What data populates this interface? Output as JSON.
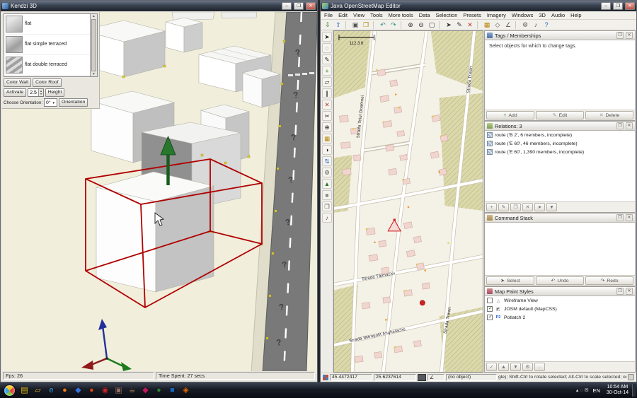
{
  "ui": {
    "icons": {
      "min": "–",
      "max": "❒",
      "close": "✕",
      "stick": "❐",
      "up": "▲",
      "down": "▼"
    }
  },
  "kendzi": {
    "title": "Kendzi 3D",
    "road_marking": "?",
    "list_items": [
      {
        "label": "flat"
      },
      {
        "label": "flat simple terraced"
      },
      {
        "label": "flat double terraced"
      }
    ],
    "color_wall": "Color Wall",
    "color_roof": "Color Roof",
    "activate": "Activate",
    "height_value": "2.5",
    "height_btn": "Height",
    "choose_orientation": "Choose Orientation:",
    "orientation_value": "0°",
    "orientation_btn": "Orientation",
    "fps": "Fps: 26",
    "time_spent": "Time Spent: 27 secs"
  },
  "josm": {
    "title": "Java OpenStreetMap Editor",
    "menus": [
      "File",
      "Edit",
      "View",
      "Tools",
      "More tools",
      "Data",
      "Selection",
      "Presets",
      "Imagery",
      "Windows",
      "3D",
      "Audio",
      "Help"
    ],
    "toolbar": [
      {
        "g": "⇩",
        "c": "#1d7a1d"
      },
      {
        "g": "⇧",
        "c": "#1f5fbf"
      },
      {
        "sep": true
      },
      {
        "g": "▣",
        "c": "#555555"
      },
      {
        "g": "❒",
        "c": "#b8860b"
      },
      {
        "sep": true
      },
      {
        "g": "↶",
        "c": "#1f8a8a"
      },
      {
        "g": "↷",
        "c": "#1f8a8a"
      },
      {
        "sep": true
      },
      {
        "g": "⊕",
        "c": "#333333"
      },
      {
        "g": "⊖",
        "c": "#333333"
      },
      {
        "g": "▢",
        "c": "#333333"
      },
      {
        "sep": true
      },
      {
        "g": "➤",
        "c": "#333333"
      },
      {
        "g": "✎",
        "c": "#333333"
      },
      {
        "g": "✕",
        "c": "#bb3333"
      },
      {
        "sep": true
      },
      {
        "g": "▦",
        "c": "#b8860b"
      },
      {
        "g": "◇",
        "c": "#555555"
      },
      {
        "g": "∠",
        "c": "#555555"
      },
      {
        "sep": true
      },
      {
        "g": "⚙",
        "c": "#555555"
      },
      {
        "g": "♪",
        "c": "#555555"
      },
      {
        "g": "?",
        "c": "#1f5fbf"
      }
    ],
    "side_toolbar": [
      {
        "g": "➤",
        "c": "#222222"
      },
      {
        "g": "◌",
        "c": "#222222"
      },
      {
        "g": "✎",
        "c": "#222222"
      },
      {
        "g": "+",
        "c": "#1d7a1d"
      },
      {
        "g": "▱",
        "c": "#222222"
      },
      {
        "g": "∥",
        "c": "#222222"
      },
      {
        "g": "✕",
        "c": "#bb3333"
      },
      {
        "g": "✂",
        "c": "#222222"
      },
      {
        "g": "⊕",
        "c": "#222222"
      },
      {
        "g": "▦",
        "c": "#b8860b"
      },
      {
        "g": "◑",
        "c": "#222222"
      },
      {
        "g": "⇅",
        "c": "#1f5fbf"
      },
      {
        "g": "⚙",
        "c": "#555555"
      },
      {
        "g": "▲",
        "c": "#2a7a2a"
      },
      {
        "g": "■",
        "c": "#888888"
      },
      {
        "g": "❒",
        "c": "#555555"
      },
      {
        "g": "♪",
        "c": "#555555"
      }
    ],
    "map": {
      "scale_label": "112.3 ft",
      "streets": [
        "Strada Teiul Doamnei",
        "Strada Traian",
        "Strada Tâlmaciei",
        "Strada Mitropolit Anghelache"
      ]
    },
    "tags_panel": {
      "title": "Tags / Memberships",
      "message": "Select objects for which to change tags.",
      "buttons": [
        {
          "g": "+",
          "label": "Add",
          "c": "#2a8a2a"
        },
        {
          "g": "✎",
          "label": "Edit",
          "c": "#999999"
        },
        {
          "g": "✕",
          "label": "Delete",
          "c": "#999999"
        }
      ]
    },
    "relations_panel": {
      "title": "Relations: 3",
      "items": [
        "route ('B 2', 6 members, incomplete)",
        "route ('E 60', 46 members, incomplete)",
        "route ('E 60', 1,390 members, incomplete)"
      ],
      "tools": [
        {
          "g": "+"
        },
        {
          "g": "✎"
        },
        {
          "g": "❐"
        },
        {
          "g": "✕"
        },
        {
          "g": "➤"
        },
        {
          "g": "▼"
        }
      ]
    },
    "command_panel": {
      "title": "Command Stack",
      "buttons": [
        {
          "g": "➤",
          "label": "Select"
        },
        {
          "g": "↶",
          "label": "Undo"
        },
        {
          "g": "↷",
          "label": "Redo"
        }
      ]
    },
    "paint_panel": {
      "title": "Map Paint Styles",
      "items": [
        {
          "label": "Wireframe View",
          "checked": false,
          "icon": "△"
        },
        {
          "label": "JOSM default (MapCSS)",
          "checked": true,
          "icon": "◩"
        },
        {
          "label": "Potlatch 2",
          "checked": true,
          "icon": "P2"
        }
      ],
      "tools": [
        {
          "g": "✓"
        },
        {
          "g": "▲"
        },
        {
          "g": "▼"
        },
        {
          "g": "⚙"
        },
        {
          "g": "…"
        }
      ]
    },
    "statusbar": {
      "lat": "45.4472417",
      "lon": "25.6237614",
      "angle_icon": "∠",
      "object": "(no object)",
      "hint": "gle); Shift-Ctrl to rotate selected; Alt-Ctrl to scale selected; or change selection"
    }
  },
  "taskbar": {
    "apps": [
      {
        "g": "▤",
        "c": "#e8c31f"
      },
      {
        "g": "▱",
        "c": "#d9a92a"
      },
      {
        "g": "e",
        "c": "#3aa0e8"
      },
      {
        "g": "●",
        "c": "#e87b1a"
      },
      {
        "g": "◆",
        "c": "#3a6fd8"
      },
      {
        "g": "●",
        "c": "#d84315"
      },
      {
        "g": "◉",
        "c": "#c62828"
      },
      {
        "g": "▣",
        "c": "#8d6e63"
      },
      {
        "g": "☕",
        "c": "#b58860"
      },
      {
        "g": "◆",
        "c": "#c2185b"
      },
      {
        "g": "●",
        "c": "#2e7d32"
      },
      {
        "g": "■",
        "c": "#1565c0"
      },
      {
        "g": "◈",
        "c": "#ef6c00"
      }
    ],
    "tray": [
      {
        "g": "▴"
      },
      {
        "g": "◌"
      },
      {
        "g": "✉"
      }
    ],
    "lang": "EN",
    "time": "10:54 AM",
    "date": "30-Oct-14"
  }
}
